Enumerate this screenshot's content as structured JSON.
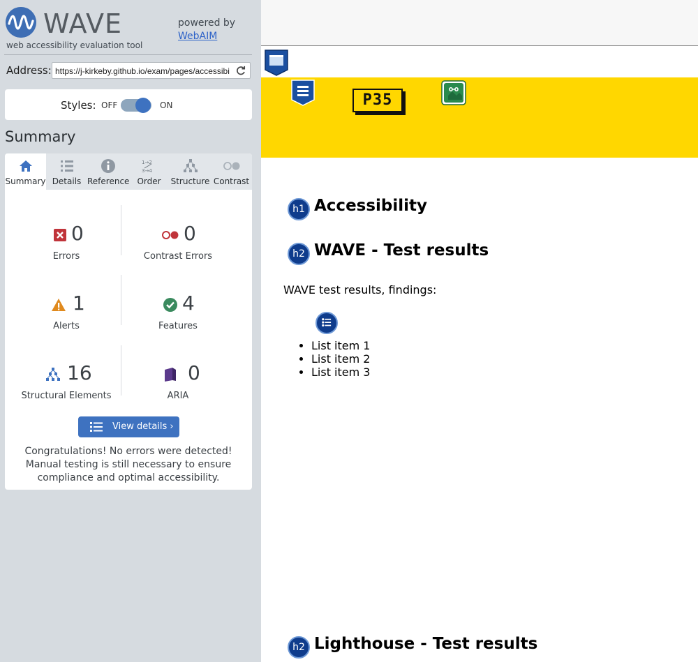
{
  "brand": {
    "logo_text": "WAVE",
    "subtitle": "web accessibility evaluation tool",
    "powered_by": "powered by",
    "webaim_link": "WebAIM"
  },
  "address": {
    "label": "Address:",
    "value": "https://j-kirkeby.github.io/exam/pages/accessibility.html"
  },
  "styles_toggle": {
    "label": "Styles:",
    "off": "OFF",
    "on": "ON",
    "state": "on"
  },
  "summary": {
    "title": "Summary",
    "tabs": [
      {
        "label": "Summary",
        "icon": "home-icon",
        "active": true
      },
      {
        "label": "Details",
        "icon": "list-icon",
        "active": false
      },
      {
        "label": "Reference",
        "icon": "info-icon",
        "active": false
      },
      {
        "label": "Order",
        "icon": "order-icon",
        "active": false
      },
      {
        "label": "Structure",
        "icon": "structure-icon",
        "active": false
      },
      {
        "label": "Contrast",
        "icon": "contrast-icon",
        "active": false
      }
    ],
    "stats": [
      {
        "label": "Errors",
        "value": "0",
        "icon": "error-icon"
      },
      {
        "label": "Contrast Errors",
        "value": "0",
        "icon": "contrast-error-icon"
      },
      {
        "label": "Alerts",
        "value": "1",
        "icon": "alert-icon"
      },
      {
        "label": "Features",
        "value": "4",
        "icon": "feature-icon"
      },
      {
        "label": "Structural Elements",
        "value": "16",
        "icon": "structure-icon"
      },
      {
        "label": "ARIA",
        "value": "0",
        "icon": "aria-icon"
      }
    ],
    "view_details": "View details ›",
    "congrats": "Congratulations! No errors were detected! Manual testing is still necessary to ensure compliance and optimal accessibility."
  },
  "page": {
    "logo_text": "P35",
    "h1": "Accessibility",
    "h2_wave": "WAVE - Test results",
    "paragraph": "WAVE test results, findings:",
    "list_items": [
      "List item 1",
      "List item 2",
      "List item 3"
    ],
    "h2_lighthouse": "Lighthouse - Test results",
    "badges": {
      "h1": "h1",
      "h2": "h2"
    }
  },
  "colors": {
    "sidebar_bg": "#d6dbe0",
    "accent": "#3e72c0",
    "banner_yellow": "#ffd700",
    "error_red": "#c0343a",
    "alert_orange": "#e08a1e",
    "feature_green": "#3a8a5e",
    "aria_purple": "#5b3a8c"
  }
}
